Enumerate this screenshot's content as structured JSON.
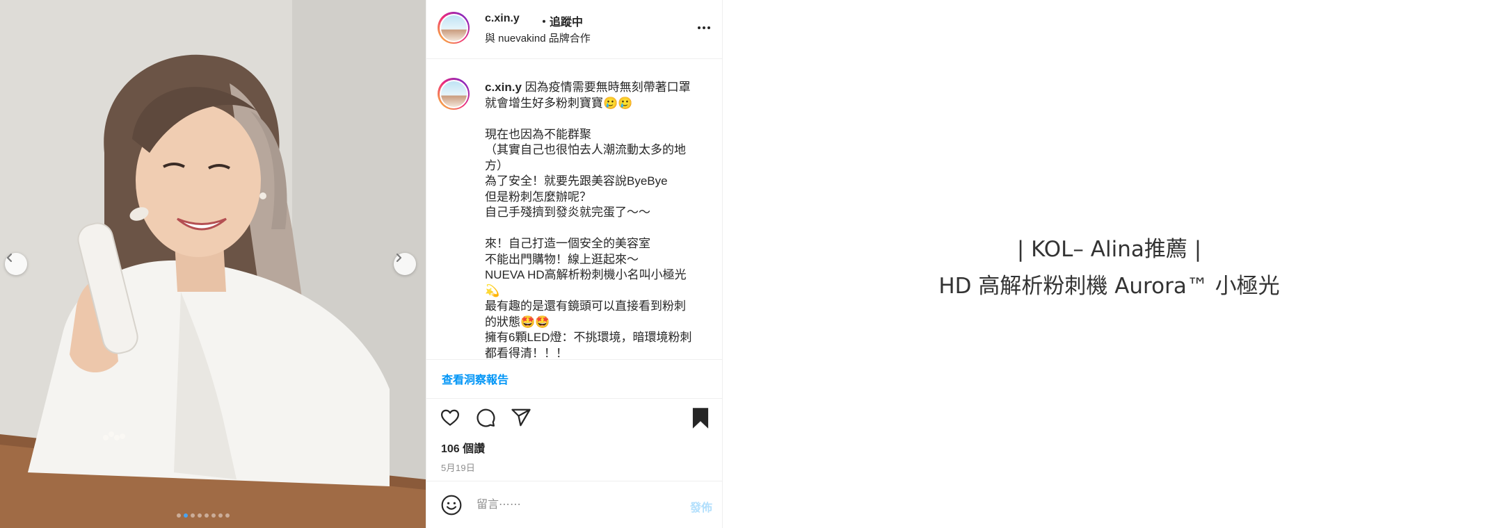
{
  "post": {
    "username": "c.xin.y",
    "follow_status": "・追蹤中",
    "partnership": "與 nuevakind 品牌合作",
    "caption_username": "c.xin.y",
    "caption_body": " 因為疫情需要無時無刻帶著口罩\n就會增生好多粉刺寶寶🥲🥲\n\n現在也因為不能群聚\n（其實自己也很怕去人潮流動太多的地\n方）\n為了安全！就要先跟美容說ByeBye\n但是粉刺怎麼辦呢？\n自己手殘擠到發炎就完蛋了～～\n\n來！自己打造一個安全的美容室\n不能出門購物！線上逛起來～\nNUEVA HD高解析粉刺機小名叫小極光\n💫\n最有趣的是還有鏡頭可以直接看到粉刺\n的狀態🤩🤩\n擁有6顆LED燈：不挑環境，暗環境粉刺\n都看得清！！！",
    "insights_link": "查看洞察報告",
    "likes": "106 個讚",
    "date": "5月19日",
    "comment_placeholder": "留言⋯⋯",
    "publish_label": "發佈"
  },
  "carousel": {
    "slide_count": 8,
    "active_index": 1
  },
  "promo": {
    "line1": "| KOL– Alina推薦 |",
    "line2": "HD 高解析粉刺機 Aurora™ 小極光"
  },
  "colors": {
    "link_blue": "#0095f6",
    "publish_disabled": "#b2dffc",
    "muted_gray": "#8e8e8e"
  }
}
